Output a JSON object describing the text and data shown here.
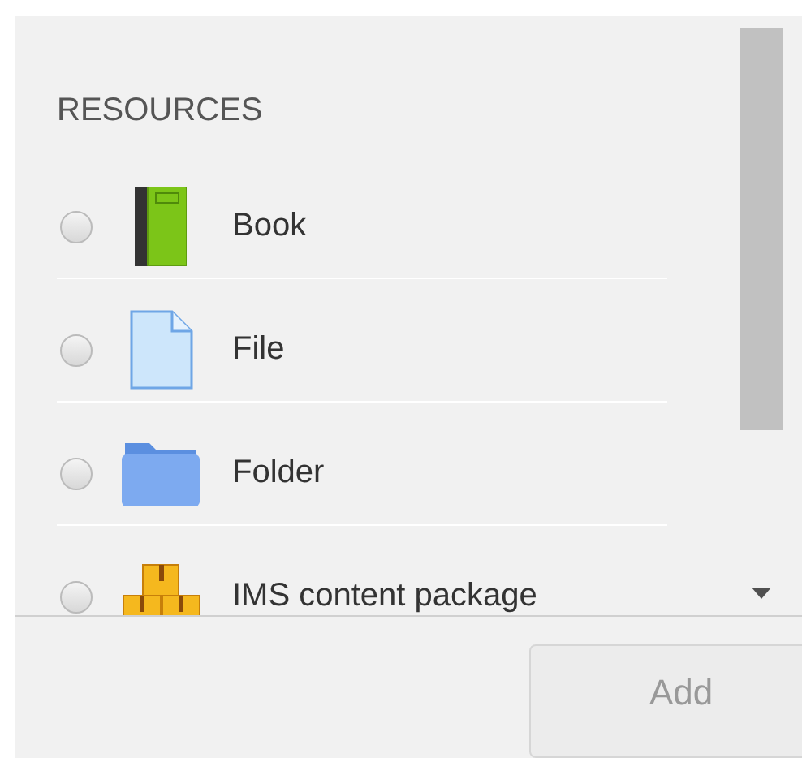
{
  "section": {
    "heading": "RESOURCES"
  },
  "items": [
    {
      "label": "Book",
      "kind": "book",
      "selected": false
    },
    {
      "label": "File",
      "kind": "file",
      "selected": false
    },
    {
      "label": "Folder",
      "kind": "folder",
      "selected": false
    },
    {
      "label": "IMS content package",
      "kind": "package",
      "selected": false
    }
  ],
  "footer": {
    "button": {
      "label": "Add",
      "disabled": true
    }
  }
}
